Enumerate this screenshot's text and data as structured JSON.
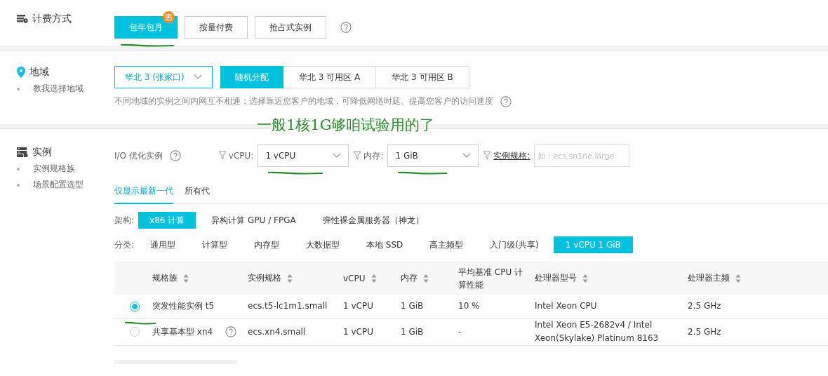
{
  "billing": {
    "label": "计费方式",
    "options": [
      {
        "label": "包年包月",
        "selected": true,
        "badge": "惠"
      },
      {
        "label": "按量付费",
        "selected": false
      },
      {
        "label": "抢占式实例",
        "selected": false
      }
    ]
  },
  "region": {
    "label": "地域",
    "links": [
      "教我选择地域"
    ],
    "select": {
      "value": "华北 3 (张家口)"
    },
    "zones": [
      {
        "label": "随机分配",
        "selected": true
      },
      {
        "label": "华北 3 可用区 A",
        "selected": false
      },
      {
        "label": "华北 3 可用区 B",
        "selected": false
      }
    ],
    "hint": "不同地域的实例之间内网互不相通；选择靠近您客户的地域，可降低网络时延、提高您客户的访问速度"
  },
  "annotation": "一般1核1G够咱试验用的了",
  "instance": {
    "label": "实例",
    "links": [
      "实例规格族",
      "场景配置选型"
    ],
    "io_label": "I/O 优化实例",
    "filters": [
      {
        "kind": "select",
        "label": "vCPU:",
        "value": "1 vCPU"
      },
      {
        "kind": "select",
        "label": "内存:",
        "value": "1 GiB"
      },
      {
        "kind": "input",
        "label": "实例规格:",
        "placeholder": "如：ecs.sn1ne.large"
      }
    ],
    "generation_tabs": [
      {
        "label": "仅显示最新一代",
        "selected": true
      },
      {
        "label": "所有代",
        "selected": false
      }
    ],
    "arch": {
      "label": "架构:",
      "options": [
        {
          "label": "x86 计算",
          "selected": true
        },
        {
          "label": "异构计算 GPU / FPGA",
          "selected": false
        },
        {
          "label": "弹性裸金属服务器（神龙）",
          "selected": false
        }
      ]
    },
    "category": {
      "label": "分类:",
      "options": [
        {
          "label": "通用型",
          "selected": false
        },
        {
          "label": "计算型",
          "selected": false
        },
        {
          "label": "内存型",
          "selected": false
        },
        {
          "label": "大数据型",
          "selected": false
        },
        {
          "label": "本地 SSD",
          "selected": false
        },
        {
          "label": "高主频型",
          "selected": false
        },
        {
          "label": "入门级(共享)",
          "selected": false
        },
        {
          "label": "1 vCPU 1 GiB",
          "selected": true
        }
      ]
    },
    "table": {
      "columns": [
        {
          "label": "规格族",
          "sortable": true
        },
        {
          "label": "实例规格",
          "sortable": true
        },
        {
          "label": "vCPU",
          "sortable": true
        },
        {
          "label": "内存",
          "sortable": true
        },
        {
          "label": "平均基准 CPU 计算性能",
          "sortable": false
        },
        {
          "label": "处理器型号",
          "sortable": true
        },
        {
          "label": "处理器主频",
          "sortable": true
        }
      ],
      "rows": [
        {
          "selected": true,
          "help": false,
          "cells": [
            "突发性能实例 t5",
            "ecs.t5-lc1m1.small",
            "1 vCPU",
            "1 GiB",
            "10 %",
            "Intel Xeon CPU",
            "2.5 GHz"
          ]
        },
        {
          "selected": false,
          "help": true,
          "cells": [
            "共享基本型 xn4",
            "ecs.xn4.small",
            "1 vCPU",
            "1 GiB",
            "-",
            "Intel Xeon E5-2682v4 / Intel Xeon(Skylake) Platinum 8163",
            "2.5 GHz"
          ]
        }
      ]
    }
  }
}
